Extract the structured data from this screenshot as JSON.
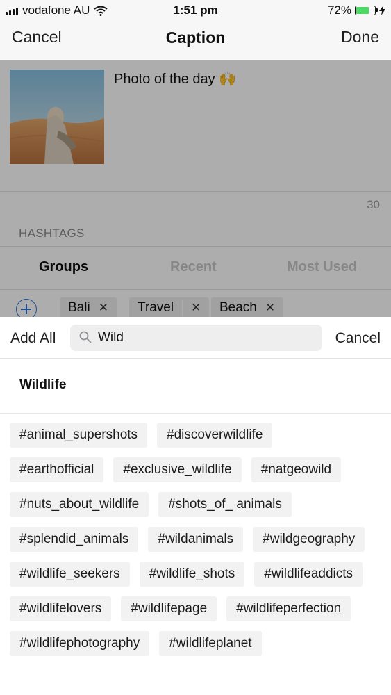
{
  "status_bar": {
    "carrier": "vodafone AU",
    "time": "1:51 pm",
    "battery": "72%",
    "battery_fill": 0.72
  },
  "nav": {
    "cancel": "Cancel",
    "title": "Caption",
    "done": "Done"
  },
  "post": {
    "caption": "Photo of the day 🙌",
    "char_count": "30"
  },
  "hashtags": {
    "label": "HASHTAGS",
    "tabs": [
      "Groups",
      "Recent",
      "Most Used"
    ],
    "active_tab": "Groups",
    "selected_groups": [
      "Bali",
      "Travel",
      "Beach"
    ]
  },
  "search": {
    "add_all": "Add All",
    "query": "Wild",
    "cancel": "Cancel"
  },
  "result": {
    "group_title": "Wildlife",
    "tag_rows": [
      [
        "#animal_supershots",
        "#discoverwildlife"
      ],
      [
        "#earthofficial",
        "#exclusive_wildlife",
        "#natgeowild"
      ],
      [
        "#nuts_about_wildlife",
        "#shots_of_ animals"
      ],
      [
        "#splendid_animals",
        "#wildanimals",
        "#wildgeography"
      ],
      [
        "#wildlife_seekers",
        "#wildlife_shots",
        "#wildlifeaddicts"
      ],
      [
        "#wildlifelovers",
        "#wildlifepage",
        "#wildlifeperfection"
      ],
      [
        "#wildlifephotography",
        "#wildlifeplanet"
      ]
    ]
  },
  "colors": {
    "accent": "#2a73d6",
    "battery_green": "#4cd964",
    "tag_bg": "#f2f2f2"
  }
}
